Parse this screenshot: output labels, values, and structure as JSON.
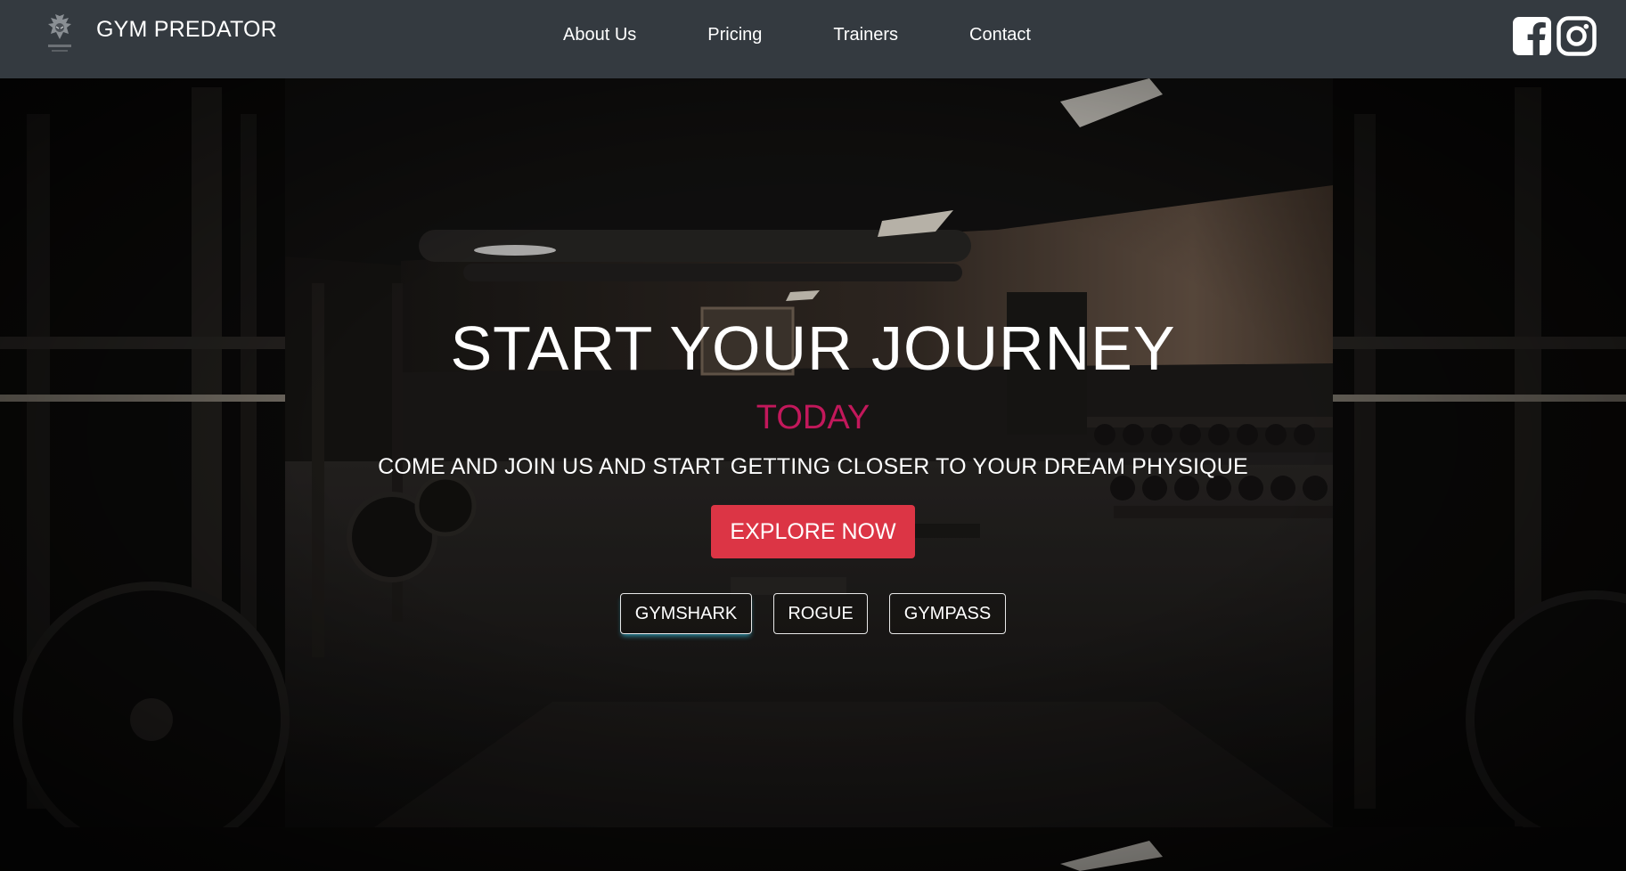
{
  "navbar": {
    "brand_name": "GYM PREDATOR",
    "brand_logo_text": "PREDATOR",
    "links": [
      {
        "label": "About Us"
      },
      {
        "label": "Pricing"
      },
      {
        "label": "Trainers"
      },
      {
        "label": "Contact"
      }
    ],
    "social": [
      {
        "icon": "facebook-icon"
      },
      {
        "icon": "instagram-icon"
      }
    ]
  },
  "hero": {
    "title": "START YOUR JOURNEY",
    "accent": "TODAY",
    "subtitle": "COME AND JOIN US AND START GETTING CLOSER TO YOUR DREAM PHYSIQUE",
    "cta_label": "EXPLORE NOW",
    "brands": [
      {
        "label": "GYMSHARK"
      },
      {
        "label": "ROGUE"
      },
      {
        "label": "GYMPASS"
      }
    ]
  },
  "colors": {
    "navbar_bg": "#343a40",
    "accent_pink": "#c2185b",
    "cta_red": "#dc3545"
  }
}
